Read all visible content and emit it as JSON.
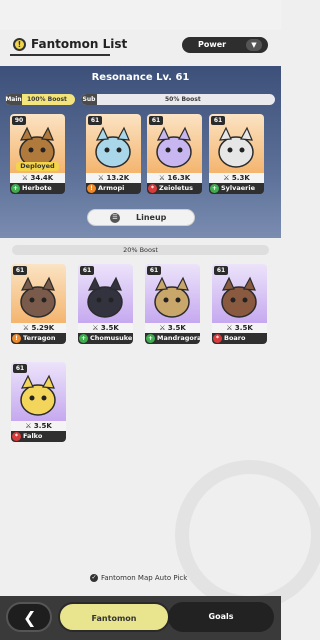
{
  "header": {
    "title": "Fantomon List",
    "sort_label": "Power"
  },
  "team": {
    "resonance": "Resonance Lv. 61",
    "main_tag": "Main",
    "main_boost": "100% Boost",
    "sub_tag": "Sub",
    "sub_boost": "50% Boost",
    "deployed_label": "Deployed",
    "lineup_label": "Lineup",
    "members": [
      {
        "level": "90",
        "power": "34.4K",
        "name": "Herbote",
        "element": "green",
        "frame": "orange",
        "body": "#b07a3c"
      },
      {
        "level": "61",
        "power": "13.2K",
        "name": "Armopi",
        "element": "orange",
        "frame": "orange",
        "body": "#a9d6e8"
      },
      {
        "level": "61",
        "power": "16.3K",
        "name": "Zeioletus",
        "element": "red",
        "frame": "orange",
        "body": "#c7b6ef"
      },
      {
        "level": "61",
        "power": "5.3K",
        "name": "Sylvaerie",
        "element": "green",
        "frame": "orange",
        "body": "#e6e6e6"
      }
    ]
  },
  "list": {
    "boost": "20% Boost",
    "items": [
      {
        "level": "61",
        "power": "5.29K",
        "name": "Terragon",
        "element": "orange",
        "frame": "orange",
        "body": "#7a5a4a"
      },
      {
        "level": "61",
        "power": "3.5K",
        "name": "Chomusuke",
        "element": "green",
        "frame": "purple",
        "body": "#333340"
      },
      {
        "level": "61",
        "power": "3.5K",
        "name": "Mandragora",
        "element": "green",
        "frame": "purple",
        "body": "#c9a66a"
      },
      {
        "level": "61",
        "power": "3.5K",
        "name": "Boaro",
        "element": "red",
        "frame": "purple",
        "body": "#8a5a40"
      },
      {
        "level": "61",
        "power": "3.5K",
        "name": "Falko",
        "element": "red",
        "frame": "purple",
        "body": "#f2d55a"
      }
    ]
  },
  "footer": {
    "autopick_label": "Fantomon Map Auto Pick",
    "tabs": [
      "Fantomon",
      "Goals"
    ]
  }
}
